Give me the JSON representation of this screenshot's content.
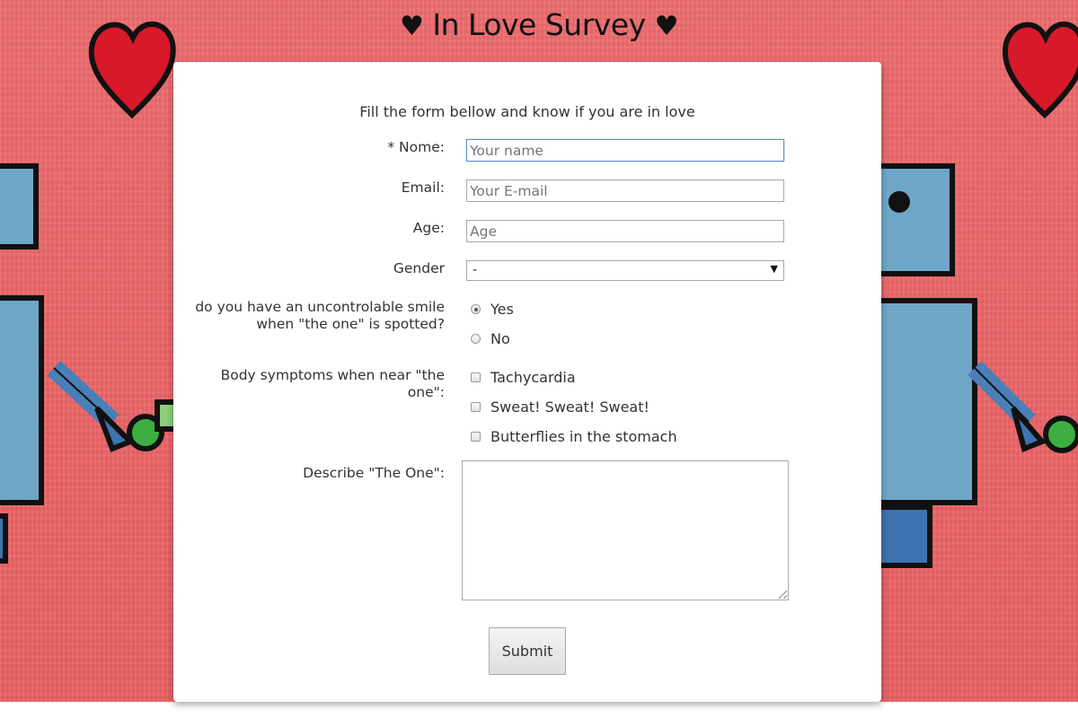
{
  "page": {
    "title": "In Love Survey",
    "title_heart": "♥",
    "intro": "Fill the form bellow and know if you are in love"
  },
  "form": {
    "name": {
      "label": "* Nome:",
      "placeholder": "Your name"
    },
    "email": {
      "label": "Email:",
      "placeholder": "Your E-mail"
    },
    "age": {
      "label": "Age:",
      "placeholder": "Age"
    },
    "gender": {
      "label": "Gender",
      "selected": "-"
    },
    "smile": {
      "label": "do you have an uncontrolable smile when \"the one\" is spotted?",
      "options": [
        "Yes",
        "No"
      ],
      "selected": "Yes"
    },
    "symptoms": {
      "label": "Body symptoms when near \"the one\":",
      "options": [
        "Tachycardia",
        "Sweat! Sweat! Sweat!",
        "Butterflies in the stomach"
      ]
    },
    "describe": {
      "label": "Describe \"The One\":"
    },
    "submit_label": "Submit"
  },
  "colors": {
    "background": "#ea6466",
    "heart": "#d7192a",
    "robot": "#6ea6c8",
    "card": "#ffffff"
  },
  "icons": {
    "title_heart": "heart-icon",
    "select_arrow": "triangle-down-icon"
  }
}
